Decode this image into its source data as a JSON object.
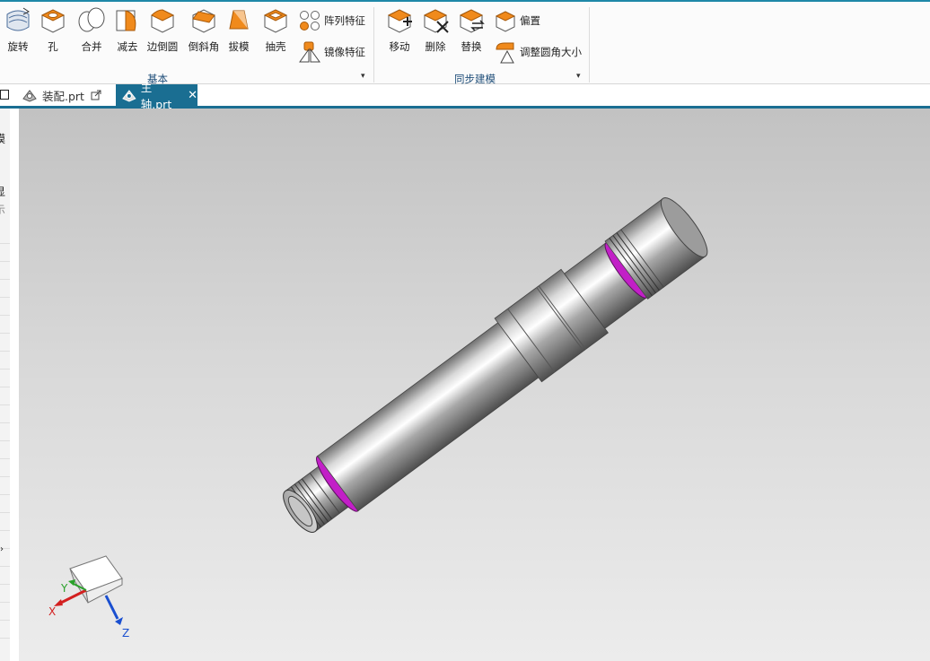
{
  "ribbon": {
    "basic_tools": [
      {
        "icon": "revolve-icon",
        "label": "旋转"
      },
      {
        "icon": "hole-icon",
        "label": "孔"
      },
      {
        "icon": "unite-icon",
        "label": "合并"
      },
      {
        "icon": "subtract-icon",
        "label": "减去"
      },
      {
        "icon": "edge-blend-icon",
        "label": "边倒圆"
      },
      {
        "icon": "chamfer-icon",
        "label": "倒斜角"
      },
      {
        "icon": "draft-icon",
        "label": "拔模"
      },
      {
        "icon": "shell-icon",
        "label": "抽壳"
      }
    ],
    "pattern_feature": {
      "icon": "pattern-feature-icon",
      "label": "阵列特征"
    },
    "mirror_feature": {
      "icon": "mirror-feature-icon",
      "label": "镜像特征"
    },
    "basic_group_label": "基本",
    "sync_tools": [
      {
        "icon": "move-face-icon",
        "label": "移动"
      },
      {
        "icon": "delete-face-icon",
        "label": "删除"
      },
      {
        "icon": "replace-face-icon",
        "label": "替换"
      }
    ],
    "offset_region": {
      "icon": "offset-region-icon",
      "label": "偏置"
    },
    "resize_blend": {
      "icon": "resize-blend-icon",
      "label": "调整圆角大小"
    },
    "sync_group_label": "同步建模"
  },
  "tabs": [
    {
      "icon": "part-icon",
      "label": "装配.prt",
      "active": false,
      "modified_icon": "external-edit-icon"
    },
    {
      "icon": "part-icon",
      "label": "主轴.prt",
      "active": true,
      "close_icon": "close-icon"
    }
  ],
  "left_panel": {
    "fragments": [
      "模",
      "显",
      "示"
    ],
    "expand_icon": "chevron-right-icon"
  },
  "triad": {
    "x_label": "X",
    "y_label": "Y",
    "z_label": "Z"
  },
  "colors": {
    "accent": "#1a6e92",
    "highlight_face": "#c21fc7",
    "feature_orange": "#f08a1c"
  }
}
